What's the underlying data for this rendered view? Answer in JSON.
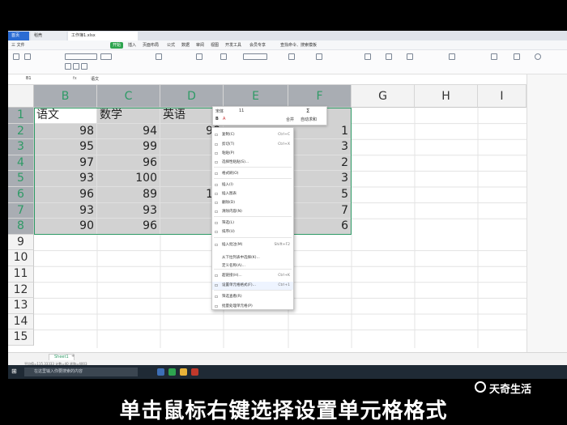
{
  "browser_tabs": [
    "首页",
    "稻壳",
    "工作簿1.xlsx"
  ],
  "menu": [
    "三 文件",
    "开始",
    "插入",
    "页面布局",
    "公式",
    "数据",
    "审阅",
    "视图",
    "开发工具",
    "会员专享",
    "查找命令、搜索模板"
  ],
  "formula_bar": {
    "name_box": "B1",
    "fx": "fx",
    "value": "语文"
  },
  "columns": [
    "B",
    "C",
    "D",
    "E",
    "F",
    "G",
    "H",
    "I"
  ],
  "rows": [
    "1",
    "2",
    "3",
    "4",
    "5",
    "6",
    "7",
    "8",
    "9",
    "10",
    "11",
    "12",
    "13",
    "14",
    "15"
  ],
  "cells": {
    "headers": [
      "语文",
      "数学",
      "英语"
    ],
    "B": [
      "98",
      "95",
      "97",
      "93",
      "96",
      "93",
      "90"
    ],
    "C": [
      "94",
      "99",
      "96",
      "100",
      "89",
      "93",
      "96"
    ],
    "D": [
      "98",
      "9",
      "9",
      "9",
      "10",
      "9",
      "9"
    ],
    "F": [
      "1",
      "3",
      "2",
      "3",
      "5",
      "7",
      "6"
    ]
  },
  "mini_toolbar": {
    "font": "宋体",
    "size": "11",
    "merge": "合并",
    "autosum": "自动求和"
  },
  "context_menu": [
    {
      "label": "复制(C)",
      "shortcut": "Ctrl+C",
      "icon": "copy-icon"
    },
    {
      "label": "剪切(T)",
      "shortcut": "Ctrl+X",
      "icon": "cut-icon"
    },
    {
      "label": "粘贴(P)",
      "shortcut": "",
      "icon": "paste-icon"
    },
    {
      "label": "选择性粘贴(S)...",
      "shortcut": "",
      "icon": "paste-special-icon"
    },
    {
      "label": "格式刷(O)",
      "shortcut": "",
      "icon": "format-brush-icon"
    },
    {
      "label": "插入(I)",
      "shortcut": "",
      "icon": "insert-icon"
    },
    {
      "label": "插入图表",
      "shortcut": "",
      "icon": "chart-icon"
    },
    {
      "label": "删除(D)",
      "shortcut": "",
      "icon": "delete-icon"
    },
    {
      "label": "清除内容(N)",
      "shortcut": "",
      "icon": "clear-icon"
    },
    {
      "label": "筛选(L)",
      "shortcut": "",
      "icon": "filter-icon"
    },
    {
      "label": "排序(U)",
      "shortcut": "",
      "icon": "sort-icon"
    },
    {
      "label": "插入批注(M)",
      "shortcut": "Shift+F2",
      "icon": "comment-icon"
    },
    {
      "label": "从下拉列表中选择(K)...",
      "shortcut": "",
      "icon": ""
    },
    {
      "label": "定义名称(A)...",
      "shortcut": "",
      "icon": ""
    },
    {
      "label": "超链接(H)...",
      "shortcut": "Ctrl+K",
      "icon": "link-icon"
    },
    {
      "label": "设置单元格格式(F)...",
      "shortcut": "Ctrl+1",
      "icon": "format-cells-icon"
    },
    {
      "label": "筛选查看(R)",
      "shortcut": "",
      "icon": "view-icon"
    },
    {
      "label": "批量处理单元格(P)",
      "shortcut": "",
      "icon": "batch-icon"
    }
  ],
  "sheet_tab": "Sheet1",
  "status": "平均值=115.33333  计数=40  求和=4003",
  "taskbar_search": "在这里输入你要搜索的内容",
  "caption": "单击鼠标右键选择设置单元格格式",
  "brand": "天奇生活"
}
